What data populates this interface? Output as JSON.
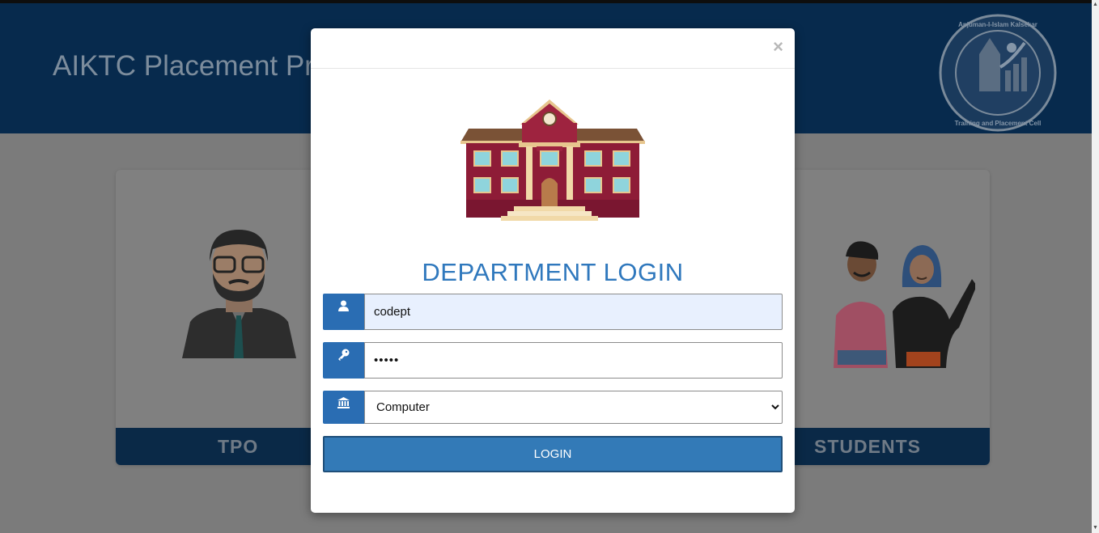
{
  "header": {
    "title": "AIKTC Placement Pr",
    "logo_text": "Anjuman-I-Islam Kalsekar Technical Campus Training and Placement Cell"
  },
  "cards": [
    {
      "label": "TPO"
    },
    {
      "label": "STUDENTS"
    }
  ],
  "modal": {
    "close_label": "×",
    "title": "DEPARTMENT LOGIN",
    "username": {
      "value": "codept",
      "icon": "user-icon"
    },
    "password": {
      "value": "•••••",
      "icon": "key-icon"
    },
    "department": {
      "selected": "Computer",
      "icon": "institution-icon",
      "options": [
        "Computer"
      ]
    },
    "login_label": "LOGIN"
  },
  "colors": {
    "accent": "#2a6db3",
    "title": "#2f78bd",
    "button": "#337ab7",
    "header_bg": "#072a4d"
  }
}
